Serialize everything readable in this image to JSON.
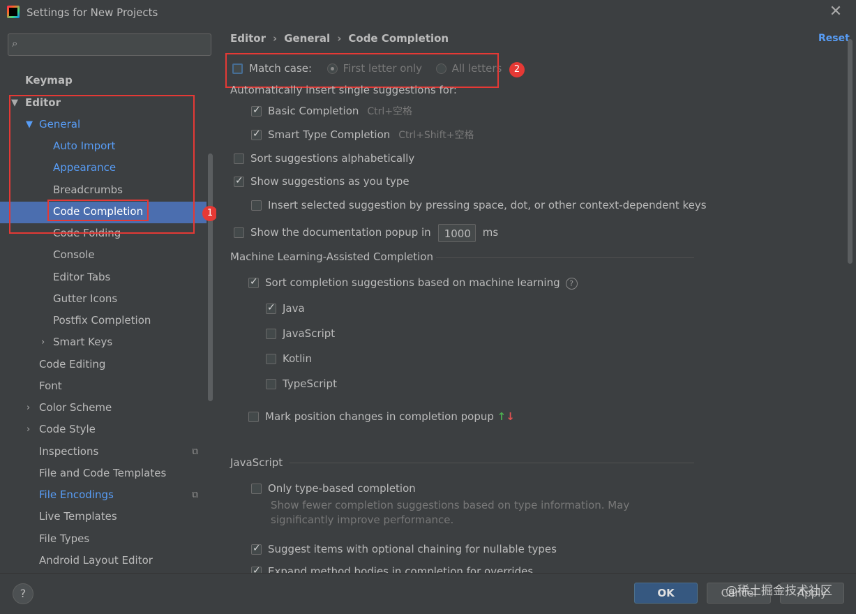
{
  "window": {
    "title": "Settings for New Projects",
    "close_label": "✕"
  },
  "search": {
    "placeholder": ""
  },
  "sidebar": {
    "keymap": "Keymap",
    "editor": "Editor",
    "general": "General",
    "auto_import": "Auto Import",
    "appearance": "Appearance",
    "breadcrumbs": "Breadcrumbs",
    "code_completion": "Code Completion",
    "code_folding": "Code Folding",
    "console": "Console",
    "editor_tabs": "Editor Tabs",
    "gutter_icons": "Gutter Icons",
    "postfix_completion": "Postfix Completion",
    "smart_keys": "Smart Keys",
    "code_editing": "Code Editing",
    "font": "Font",
    "color_scheme": "Color Scheme",
    "code_style": "Code Style",
    "inspections": "Inspections",
    "file_code_templates": "File and Code Templates",
    "file_encodings": "File Encodings",
    "live_templates": "Live Templates",
    "file_types": "File Types",
    "android_layout_editor": "Android Layout Editor"
  },
  "annotations": {
    "badge1": "1",
    "badge2": "2"
  },
  "breadcrumb": {
    "part1": "Editor",
    "part2": "General",
    "part3": "Code Completion"
  },
  "header": {
    "reset": "Reset"
  },
  "content": {
    "match_case": "Match case:",
    "first_letter_only": "First letter only",
    "all_letters": "All letters",
    "auto_insert_label": "Automatically insert single suggestions for:",
    "basic_completion": "Basic Completion",
    "basic_shortcut": "Ctrl+空格",
    "smart_type_completion": "Smart Type Completion",
    "smart_shortcut": "Ctrl+Shift+空格",
    "sort_alpha": "Sort suggestions alphabetically",
    "show_as_type": "Show suggestions as you type",
    "insert_selected": "Insert selected suggestion by pressing space, dot, or other context-dependent keys",
    "show_doc_popup": "Show the documentation popup in",
    "doc_popup_delay": "1000",
    "doc_popup_unit": "ms",
    "ml_section": "Machine Learning-Assisted Completion",
    "ml_sort": "Sort completion suggestions based on machine learning",
    "lang_java": "Java",
    "lang_javascript": "JavaScript",
    "lang_kotlin": "Kotlin",
    "lang_typescript": "TypeScript",
    "mark_position": "Mark position changes in completion popup",
    "js_section": "JavaScript",
    "only_type_based": "Only type-based completion",
    "only_type_based_desc1": "Show fewer completion suggestions based on type information. May",
    "only_type_based_desc2": "significantly improve performance.",
    "suggest_optional_chaining": "Suggest items with optional chaining for nullable types",
    "expand_method_bodies": "Expand method bodies in completion for overrides"
  },
  "buttons": {
    "help": "?",
    "ok": "OK",
    "cancel": "Cancel",
    "apply": "Apply"
  },
  "watermark": "@稀土掘金技术社区",
  "colors": {
    "accent": "#589df6",
    "selection": "#4b6eaf",
    "annotation": "#e53935",
    "background": "#3c3f41"
  }
}
